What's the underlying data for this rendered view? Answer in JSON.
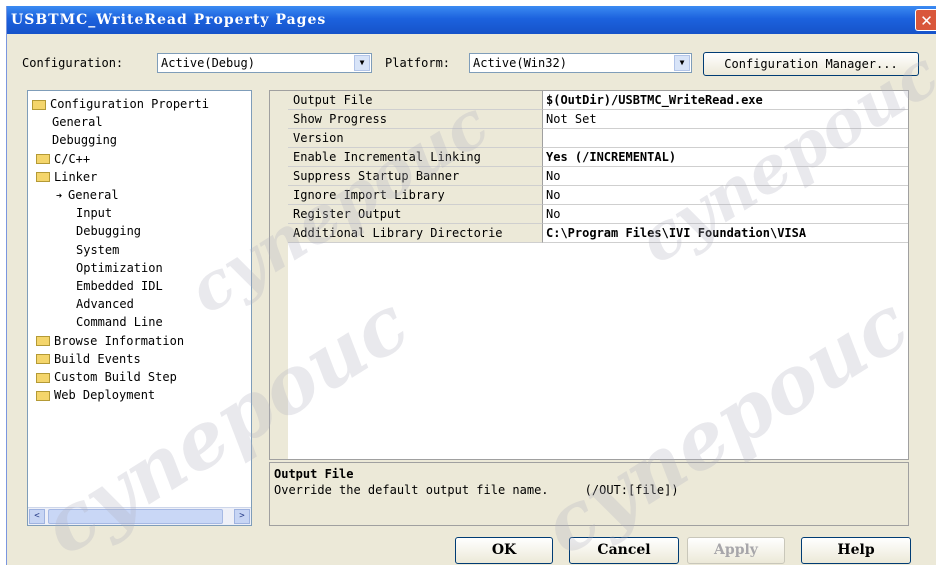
{
  "window": {
    "title": "USBTMC_WriteRead Property Pages",
    "close_glyph": "✕"
  },
  "config_bar": {
    "configuration_label": "Configuration:",
    "configuration_value": "Active(Debug)",
    "platform_label": "Platform:",
    "platform_value": "Active(Win32)",
    "config_manager_button": "Configuration Manager..."
  },
  "tree": {
    "items": [
      {
        "label": "Configuration Properti",
        "icon": "open-folder-icon"
      },
      {
        "label": "General"
      },
      {
        "label": "Debugging"
      },
      {
        "label": "C/C++",
        "icon": "folder-icon"
      },
      {
        "label": "Linker",
        "icon": "open-folder-icon"
      },
      {
        "label": "General",
        "selected": true,
        "icon": "arrow-pointer-icon"
      },
      {
        "label": "Input"
      },
      {
        "label": "Debugging"
      },
      {
        "label": "System"
      },
      {
        "label": "Optimization"
      },
      {
        "label": "Embedded IDL"
      },
      {
        "label": "Advanced"
      },
      {
        "label": "Command Line"
      },
      {
        "label": "Browse Information",
        "icon": "folder-icon"
      },
      {
        "label": "Build Events",
        "icon": "folder-icon"
      },
      {
        "label": "Custom Build Step",
        "icon": "folder-icon"
      },
      {
        "label": "Web Deployment",
        "icon": "folder-icon"
      }
    ],
    "scroll_left": "<",
    "scroll_right": ">"
  },
  "properties": {
    "rows": [
      {
        "name": "Output File",
        "value": "$(OutDir)/USBTMC_WriteRead.exe",
        "bold": true
      },
      {
        "name": "Show Progress",
        "value": "Not Set",
        "bold": false
      },
      {
        "name": "Version",
        "value": "",
        "bold": false
      },
      {
        "name": "Enable Incremental Linking",
        "value": "Yes (/INCREMENTAL)",
        "bold": true
      },
      {
        "name": "Suppress Startup Banner",
        "value": "No",
        "bold": false
      },
      {
        "name": "Ignore Import Library",
        "value": "No",
        "bold": false
      },
      {
        "name": "Register Output",
        "value": "No",
        "bold": false
      },
      {
        "name": "Additional Library Directorie",
        "value": "C:\\Program Files\\IVI Foundation\\VISA",
        "bold": true
      }
    ]
  },
  "description": {
    "title": "Output File",
    "text": "Override the default output file name.     (/OUT:[file])"
  },
  "buttons": {
    "ok": "OK",
    "cancel": "Cancel",
    "apply": "Apply",
    "help": "Help"
  },
  "watermark": {
    "text": "супероис"
  },
  "colors": {
    "titlebar": "#1c62de",
    "dialog_bg": "#ece9d8",
    "border_blue": "#7f9db9"
  }
}
